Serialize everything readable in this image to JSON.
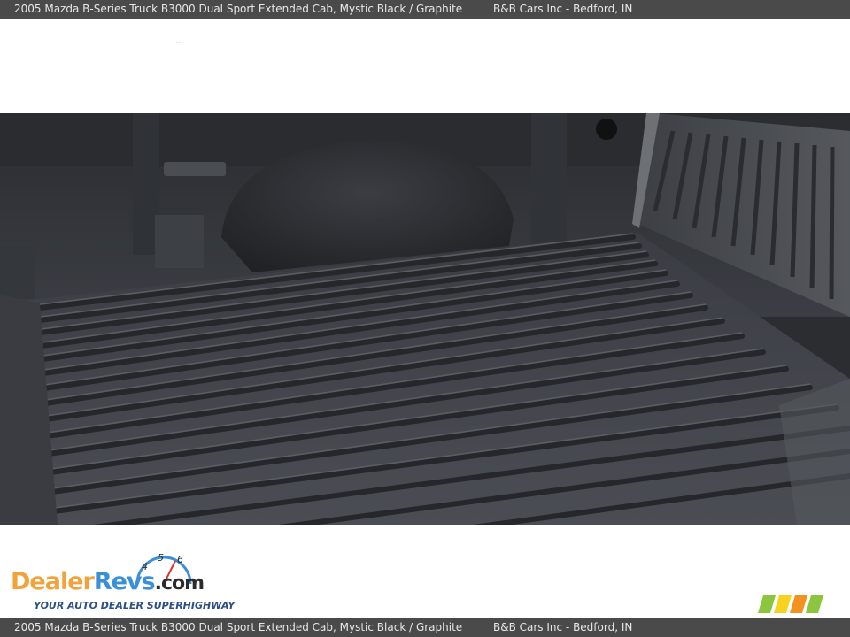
{
  "header": {
    "title": "2005 Mazda B-Series Truck B3000 Dual Sport Extended Cab,  Mystic Black / Graphite",
    "dealer": "B&B Cars Inc - Bedford, IN"
  },
  "footer": {
    "title": "2005 Mazda B-Series Truck B3000 Dual Sport Extended Cab,  Mystic Black / Graphite",
    "dealer": "B&B Cars Inc - Bedford, IN"
  },
  "photo": {
    "subject": "truck-bed-liner"
  },
  "logo": {
    "word_a": "Dealer",
    "word_b": "Revs",
    "word_c": ".com",
    "tagline": "YOUR AUTO DEALER SUPERHIGHWAY",
    "gauge_digits": [
      "4",
      "5",
      "6"
    ]
  },
  "colors": {
    "bar_bg": "#4a4a4a",
    "bar_text": "#e8e8e8",
    "logo_orange": "#f2a23a",
    "logo_blue": "#3a8fd6",
    "brand_stripes": [
      "#8cc63f",
      "#f7d21e",
      "#f39221",
      "#8cc63f"
    ]
  }
}
